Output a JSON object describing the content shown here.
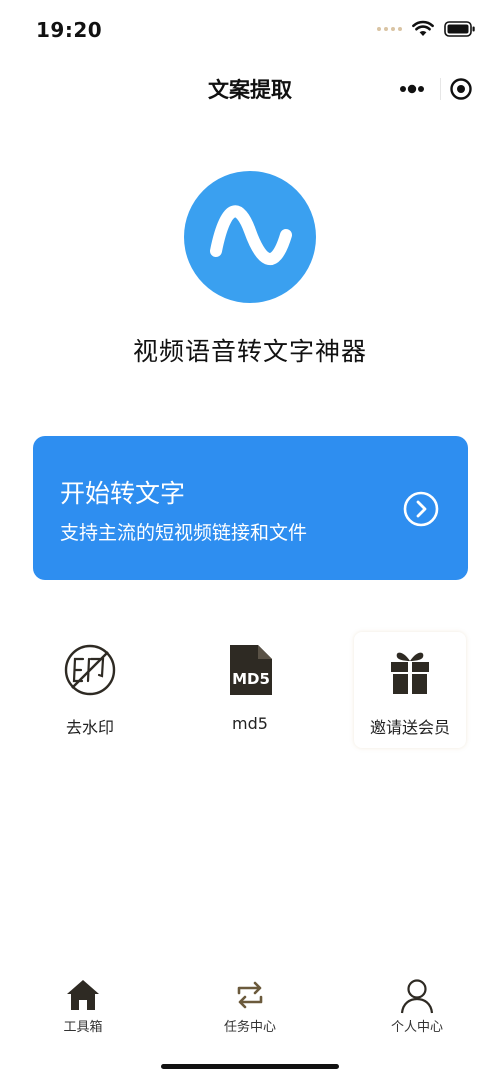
{
  "status_bar": {
    "time": "19:20"
  },
  "nav": {
    "title": "文案提取"
  },
  "hero": {
    "slogan": "视频语音转文字神器",
    "logo_icon": "waveform-logo-icon",
    "logo_color": "#3aa0f0"
  },
  "start_card": {
    "title": "开始转文字",
    "subtitle": "支持主流的短视频链接和文件",
    "icon": "chevron-right-circle-icon",
    "color": "#2e8ef0"
  },
  "tools": [
    {
      "label": "去水印",
      "icon": "no-watermark-icon"
    },
    {
      "label": "md5",
      "icon": "md5-file-icon"
    },
    {
      "label": "邀请送会员",
      "icon": "gift-icon"
    }
  ],
  "tab_bar": [
    {
      "label": "工具箱",
      "icon": "home-icon",
      "active": true
    },
    {
      "label": "任务中心",
      "icon": "swap-arrows-icon",
      "active": false
    },
    {
      "label": "个人中心",
      "icon": "user-icon",
      "active": false
    }
  ],
  "colors": {
    "accent": "#2e8ef0",
    "icon_dark": "#2e2a23",
    "icon_muted": "#6b5a3c"
  }
}
